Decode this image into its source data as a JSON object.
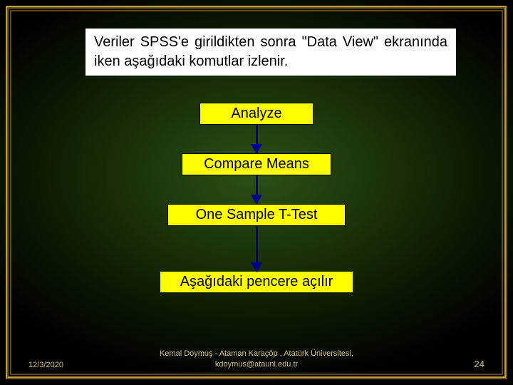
{
  "intro": "Veriler SPSS'e girildikten sonra \"Data View\" ekranında iken aşağıdaki komutlar izlenir.",
  "steps": {
    "analyze": "Analyze",
    "compare": "Compare Means",
    "onesample": "One Sample T-Test",
    "final": "Aşağıdaki pencere açılır"
  },
  "footer": {
    "date": "12/3/2020",
    "author": "Kemal Doymuş - Ataman Karaçöp , Atatürk Üniversitesi, kdoymus@atauni.edu.tr",
    "page": "24"
  }
}
